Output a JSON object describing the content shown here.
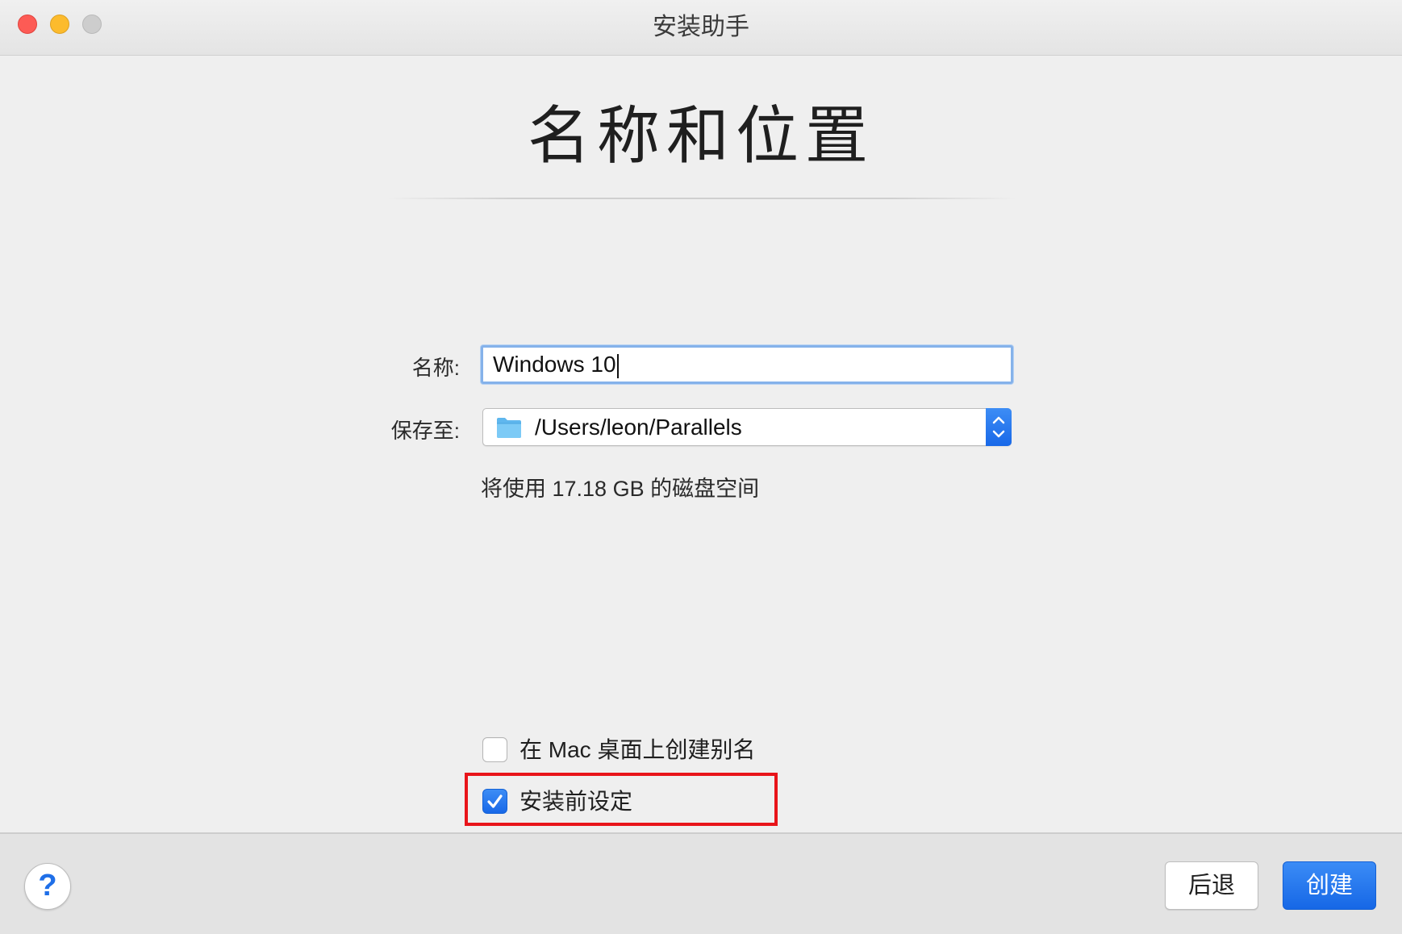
{
  "window": {
    "title": "安装助手"
  },
  "heading": "名称和位置",
  "form": {
    "name_label": "名称:",
    "name_value": "Windows 10",
    "save_label": "保存至:",
    "save_path": "/Users/leon/Parallels",
    "disk_info": "将使用 17.18 GB 的磁盘空间"
  },
  "options": {
    "alias_label": "在 Mac 桌面上创建别名",
    "alias_checked": false,
    "pre_install_label": "安装前设定",
    "pre_install_checked": true
  },
  "footer": {
    "help_label": "?",
    "back_label": "后退",
    "create_label": "创建"
  },
  "colors": {
    "accent": "#1a6ce8",
    "highlight": "#e8141a",
    "close": "#fd5b55",
    "minimize": "#fcbb2d",
    "zoom": "#cdcdcd"
  },
  "icons": {
    "folder": "folder-icon",
    "stepper": "chevron-up-down-icon",
    "check": "checkmark-icon"
  }
}
